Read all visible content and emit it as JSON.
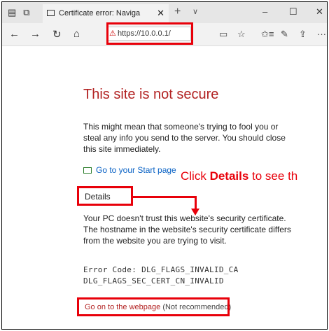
{
  "browser": {
    "tab_title": "Certificate error: Naviga",
    "tab_close": "✕",
    "new_tab": "+",
    "tab_menu": "∨",
    "minimize": "–",
    "maximize": "☐",
    "close": "✕",
    "back": "←",
    "forward": "→",
    "refresh": "↻",
    "home": "⌂",
    "warning_symbol": "⚠",
    "url": "https://10.0.0.1/",
    "reading_view": "▭",
    "favorite": "☆",
    "favorites_hub": "✩≡",
    "notes": "✎",
    "share": "⇪",
    "more": "···"
  },
  "page": {
    "title": "This site is not secure",
    "description": "This might mean that someone's trying to fool you or steal any info you send to the server. You should close this site immediately.",
    "start_page_link": "Go to your Start page",
    "details_label": "Details",
    "details_text_1": "Your PC doesn't trust this website's security certificate.",
    "details_text_2": "The hostname in the website's security certificate differs from the website you are trying to visit.",
    "error_code_line_1": "Error Code: DLG_FLAGS_INVALID_CA",
    "error_code_line_2": "DLG_FLAGS_SEC_CERT_CN_INVALID",
    "go_on_link": "Go on to the webpage",
    "not_recommended": "(Not recommended)"
  },
  "annotation": {
    "prefix": "Click ",
    "bold": "Details",
    "suffix": " to see th",
    "color": "#e8000a"
  }
}
